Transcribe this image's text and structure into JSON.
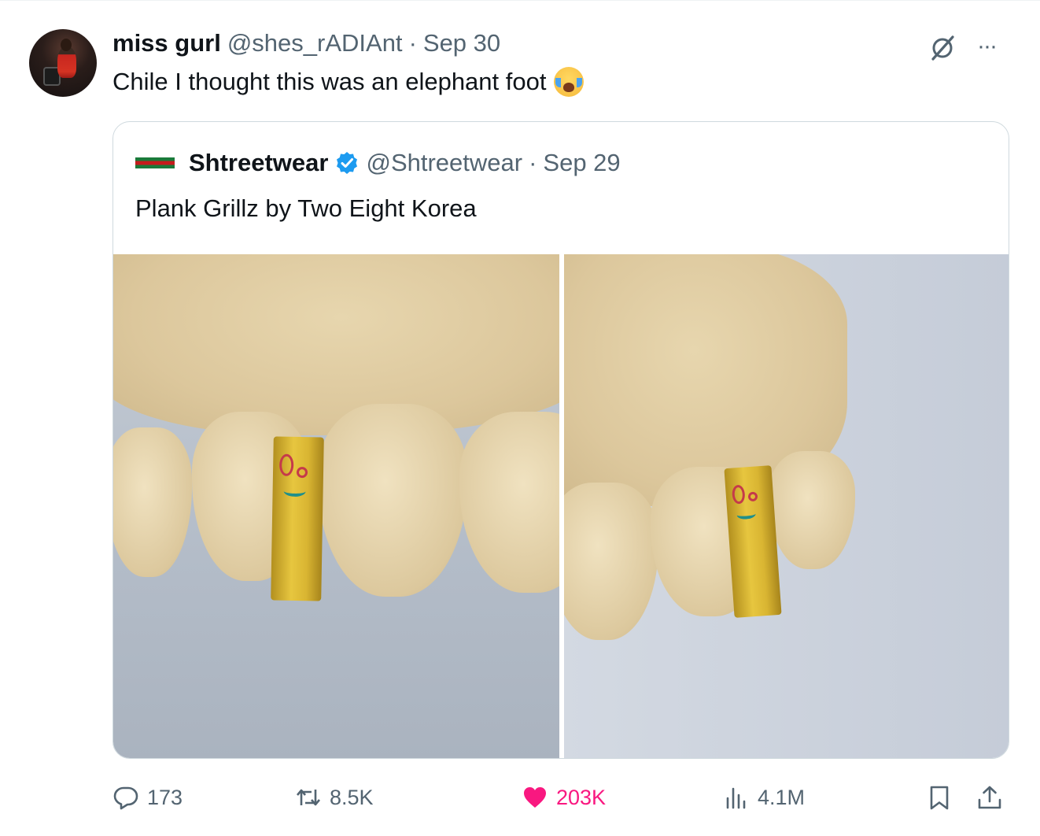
{
  "tweet": {
    "author": {
      "display_name": "miss gurl",
      "handle": "@shes_rADIAnt",
      "separator": "·",
      "date": "Sep 30"
    },
    "text": "Chile I thought this was an elephant foot",
    "emoji": "loudly-crying-face"
  },
  "quote": {
    "author": {
      "display_name": "Shtreetwear",
      "verified": true,
      "handle": "@Shtreetwear",
      "separator": "·",
      "date": "Sep 29"
    },
    "text": "Plank Grillz by Two Eight Korea",
    "media_count": 2
  },
  "actions": {
    "replies": "173",
    "reposts": "8.5K",
    "likes": "203K",
    "views": "4.1M"
  },
  "colors": {
    "text_primary": "#0f1419",
    "text_secondary": "#536471",
    "like": "#f91880",
    "verified": "#1d9bf0",
    "border": "#cfd9de"
  },
  "icons": {
    "reply": "speech-bubble-icon",
    "repost": "repost-arrows-icon",
    "like": "heart-icon",
    "views": "bar-chart-icon",
    "bookmark": "bookmark-icon",
    "share": "share-upload-icon",
    "more": "more-dots-icon",
    "grok": "grok-slash-circle-icon"
  }
}
